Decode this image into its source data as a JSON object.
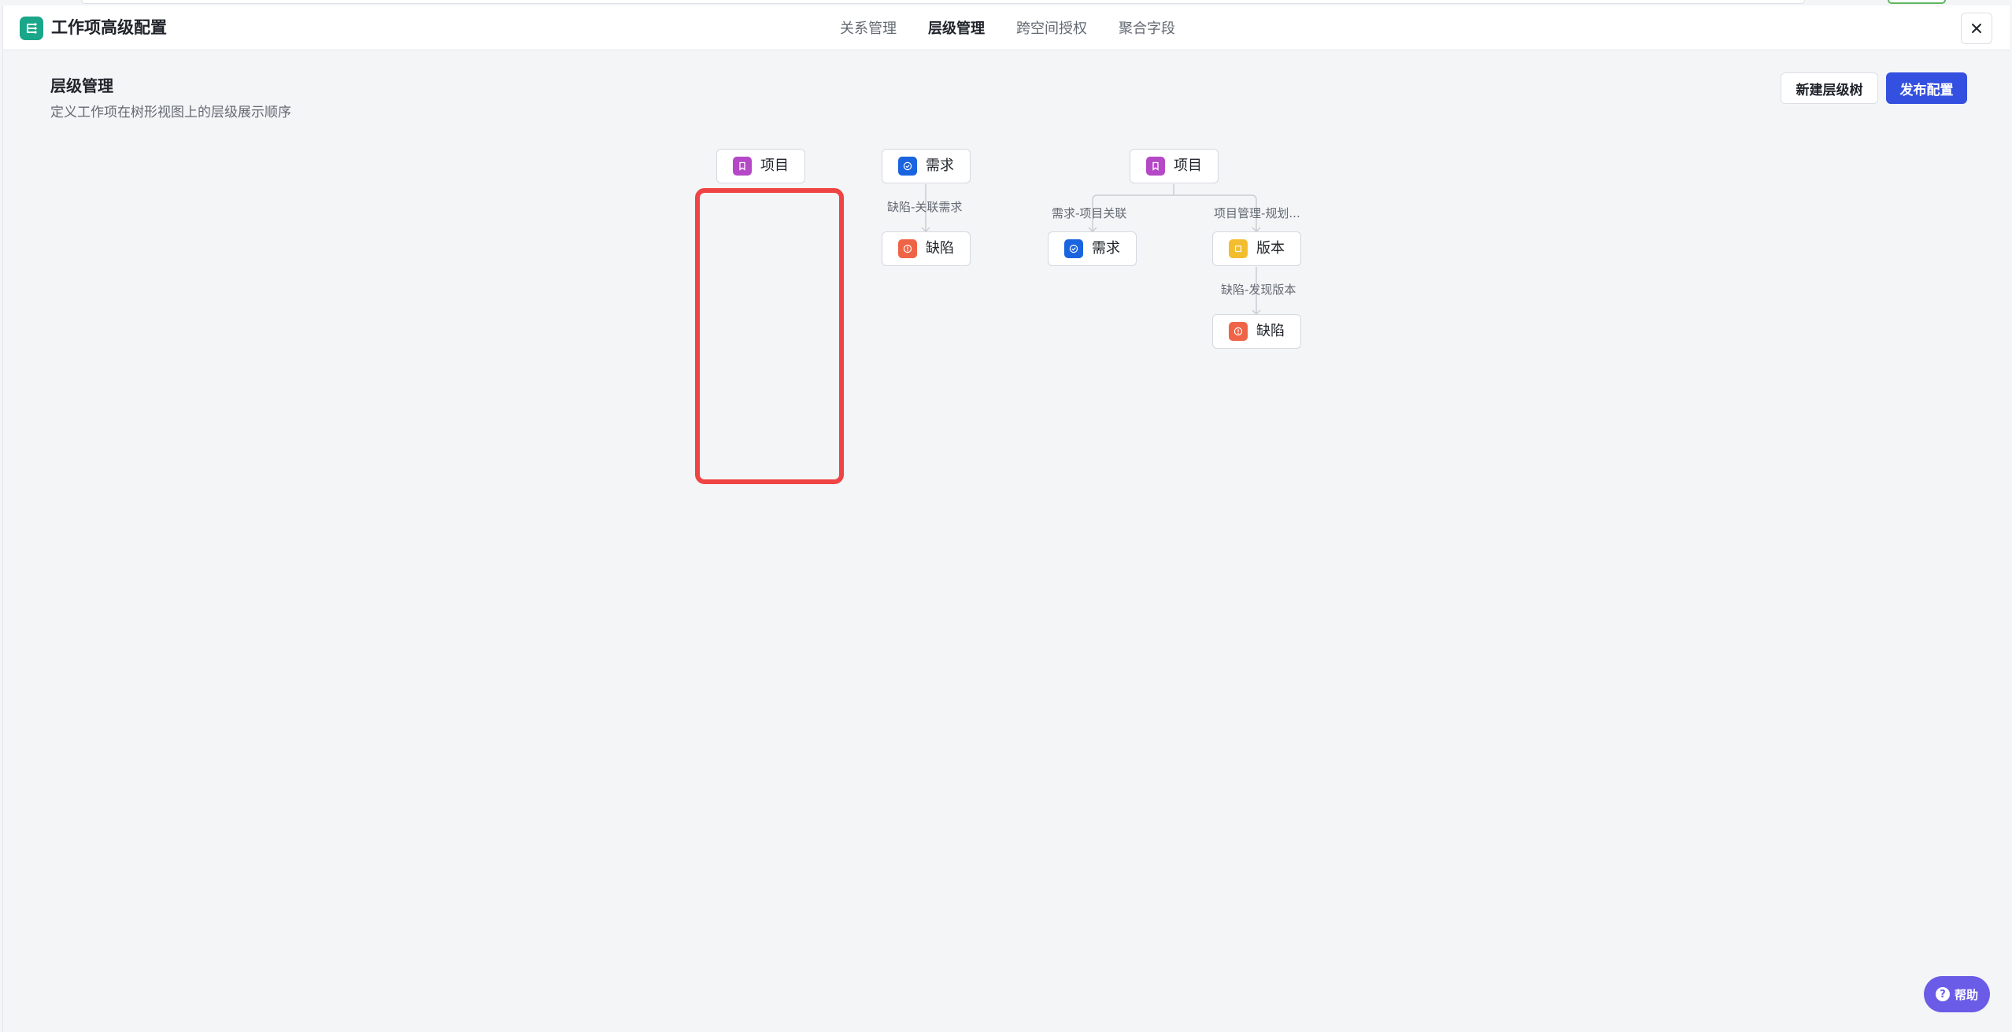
{
  "header": {
    "app_title": "工作项高级配置",
    "tabs": [
      {
        "label": "关系管理",
        "active": false
      },
      {
        "label": "层级管理",
        "active": true
      },
      {
        "label": "跨空间授权",
        "active": false
      },
      {
        "label": "聚合字段",
        "active": false
      }
    ],
    "close_icon": "close-icon"
  },
  "page": {
    "title": "层级管理",
    "description": "定义工作项在树形视图上的层级展示顺序",
    "new_tree_label": "新建层级树",
    "publish_label": "发布配置"
  },
  "trees": [
    {
      "nodes": [
        {
          "label": "项目",
          "icon": "bookmark-icon",
          "color": "#b548c6"
        }
      ]
    },
    {
      "nodes": [
        {
          "label": "需求",
          "icon": "check-circle-icon",
          "color": "#1a64e0"
        },
        {
          "label": "缺陷",
          "icon": "alert-circle-icon",
          "color": "#ef6446"
        }
      ],
      "edges": [
        {
          "label": "缺陷-关联需求"
        }
      ]
    },
    {
      "nodes": [
        {
          "label": "项目",
          "icon": "bookmark-icon",
          "color": "#b548c6"
        },
        {
          "label": "需求",
          "icon": "check-circle-icon",
          "color": "#1a64e0"
        },
        {
          "label": "版本",
          "icon": "square-icon",
          "color": "#f3bd30"
        },
        {
          "label": "缺陷",
          "icon": "alert-circle-icon",
          "color": "#ef6446"
        }
      ],
      "edges": [
        {
          "label": "需求-项目关联"
        },
        {
          "label": "项目管理-规划..."
        },
        {
          "label": "缺陷-发现版本"
        }
      ]
    }
  ],
  "help": {
    "label": "帮助"
  },
  "colors": {
    "accent": "#3450e0",
    "highlight": "#ef4444",
    "help": "#6b5ce7",
    "logo": "#1aa689"
  }
}
